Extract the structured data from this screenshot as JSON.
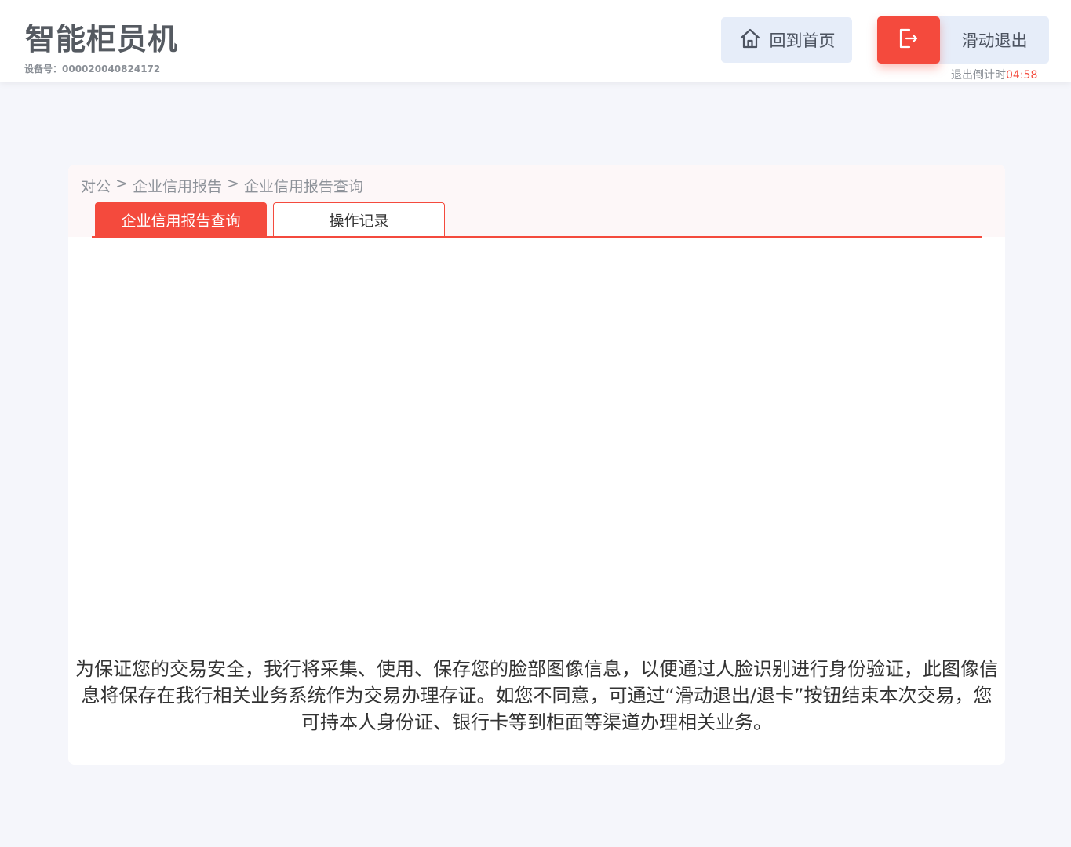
{
  "header": {
    "app_title": "智能柜员机",
    "device_label": "设备号：000020040824172",
    "home_button": {
      "label": "回到首页",
      "icon": "home-icon"
    },
    "exit_slider": {
      "label": "滑动退出",
      "icon": "exit-icon"
    },
    "countdown": {
      "label": "退出倒计时",
      "time": "04:58"
    }
  },
  "colors": {
    "accent": "#f44a3d",
    "button_bg": "#e6edf9",
    "page_bg": "#f5f6fb"
  },
  "breadcrumb": {
    "items": [
      "对公",
      "企业信用报告",
      "企业信用报告查询"
    ],
    "separator": ">"
  },
  "tabs": [
    {
      "label": "企业信用报告查询",
      "active": true
    },
    {
      "label": "操作记录",
      "active": false
    }
  ],
  "notice": "为保证您的交易安全，我行将采集、使用、保存您的脸部图像信息，以便通过人脸识别进行身份验证，此图像信息将保存在我行相关业务系统作为交易办理存证。如您不同意，可通过“滑动退出/退卡”按钮结束本次交易，您可持本人身份证、银行卡等到柜面等渠道办理相关业务。"
}
